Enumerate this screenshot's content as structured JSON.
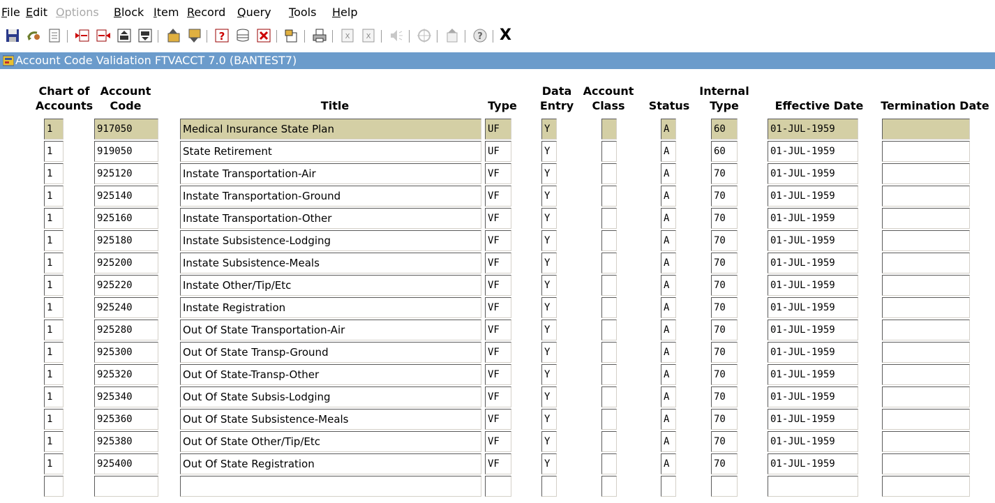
{
  "menu": [
    {
      "label": "File",
      "enabled": true
    },
    {
      "label": "Edit",
      "enabled": true
    },
    {
      "label": "Options",
      "enabled": false
    },
    {
      "label": "Block",
      "enabled": true
    },
    {
      "label": "Item",
      "enabled": true
    },
    {
      "label": "Record",
      "enabled": true
    },
    {
      "label": "Query",
      "enabled": true
    },
    {
      "label": "Tools",
      "enabled": true
    },
    {
      "label": "Help",
      "enabled": true
    }
  ],
  "toolbar": {
    "buttons": [
      "save-icon",
      "rollback-icon",
      "print-form-icon",
      "insert-record-icon",
      "remove-record-icon",
      "previous-block-icon",
      "next-block-icon",
      "previous-record-icon",
      "next-record-icon",
      "enter-query-icon",
      "execute-query-icon",
      "cancel-query-icon",
      "options-icon",
      "print-icon",
      "clear-record-icon",
      "clear-form-icon",
      "speaker-icon",
      "target-icon",
      "exit-icon",
      "help-icon"
    ],
    "exit_label": "X"
  },
  "window": {
    "title": "Account Code Validation  FTVACCT  7.0  (BANTEST7)"
  },
  "columns": {
    "chart_of_accounts": [
      "Chart of",
      "Accounts"
    ],
    "account_code": [
      "Account",
      "Code"
    ],
    "title": "Title",
    "type": "Type",
    "data_entry": [
      "Data",
      "Entry"
    ],
    "account_class": [
      "Account",
      "Class"
    ],
    "status": "Status",
    "internal_type": [
      "Internal",
      "Type"
    ],
    "effective_date": "Effective Date",
    "termination_date": "Termination Date"
  },
  "rows": [
    {
      "coas": "1",
      "acct": "917050",
      "title": "Medical Insurance State Plan",
      "type": "UF",
      "data_entry": "Y",
      "acct_class": "",
      "status": "A",
      "internal_type": "60",
      "eff_date": "01-JUL-1959",
      "term_date": ""
    },
    {
      "coas": "1",
      "acct": "919050",
      "title": "State Retirement",
      "type": "UF",
      "data_entry": "Y",
      "acct_class": "",
      "status": "A",
      "internal_type": "60",
      "eff_date": "01-JUL-1959",
      "term_date": ""
    },
    {
      "coas": "1",
      "acct": "925120",
      "title": "Instate Transportation-Air",
      "type": "VF",
      "data_entry": "Y",
      "acct_class": "",
      "status": "A",
      "internal_type": "70",
      "eff_date": "01-JUL-1959",
      "term_date": ""
    },
    {
      "coas": "1",
      "acct": "925140",
      "title": "Instate Transportation-Ground",
      "type": "VF",
      "data_entry": "Y",
      "acct_class": "",
      "status": "A",
      "internal_type": "70",
      "eff_date": "01-JUL-1959",
      "term_date": ""
    },
    {
      "coas": "1",
      "acct": "925160",
      "title": "Instate Transportation-Other",
      "type": "VF",
      "data_entry": "Y",
      "acct_class": "",
      "status": "A",
      "internal_type": "70",
      "eff_date": "01-JUL-1959",
      "term_date": ""
    },
    {
      "coas": "1",
      "acct": "925180",
      "title": "Instate Subsistence-Lodging",
      "type": "VF",
      "data_entry": "Y",
      "acct_class": "",
      "status": "A",
      "internal_type": "70",
      "eff_date": "01-JUL-1959",
      "term_date": ""
    },
    {
      "coas": "1",
      "acct": "925200",
      "title": "Instate Subsistence-Meals",
      "type": "VF",
      "data_entry": "Y",
      "acct_class": "",
      "status": "A",
      "internal_type": "70",
      "eff_date": "01-JUL-1959",
      "term_date": ""
    },
    {
      "coas": "1",
      "acct": "925220",
      "title": "Instate Other/Tip/Etc",
      "type": "VF",
      "data_entry": "Y",
      "acct_class": "",
      "status": "A",
      "internal_type": "70",
      "eff_date": "01-JUL-1959",
      "term_date": ""
    },
    {
      "coas": "1",
      "acct": "925240",
      "title": "Instate Registration",
      "type": "VF",
      "data_entry": "Y",
      "acct_class": "",
      "status": "A",
      "internal_type": "70",
      "eff_date": "01-JUL-1959",
      "term_date": ""
    },
    {
      "coas": "1",
      "acct": "925280",
      "title": "Out Of State Transportation-Air",
      "type": "VF",
      "data_entry": "Y",
      "acct_class": "",
      "status": "A",
      "internal_type": "70",
      "eff_date": "01-JUL-1959",
      "term_date": ""
    },
    {
      "coas": "1",
      "acct": "925300",
      "title": "Out Of State Transp-Ground",
      "type": "VF",
      "data_entry": "Y",
      "acct_class": "",
      "status": "A",
      "internal_type": "70",
      "eff_date": "01-JUL-1959",
      "term_date": ""
    },
    {
      "coas": "1",
      "acct": "925320",
      "title": "Out Of State-Transp-Other",
      "type": "VF",
      "data_entry": "Y",
      "acct_class": "",
      "status": "A",
      "internal_type": "70",
      "eff_date": "01-JUL-1959",
      "term_date": ""
    },
    {
      "coas": "1",
      "acct": "925340",
      "title": "Out Of State Subsis-Lodging",
      "type": "VF",
      "data_entry": "Y",
      "acct_class": "",
      "status": "A",
      "internal_type": "70",
      "eff_date": "01-JUL-1959",
      "term_date": ""
    },
    {
      "coas": "1",
      "acct": "925360",
      "title": "Out Of State Subsistence-Meals",
      "type": "VF",
      "data_entry": "Y",
      "acct_class": "",
      "status": "A",
      "internal_type": "70",
      "eff_date": "01-JUL-1959",
      "term_date": ""
    },
    {
      "coas": "1",
      "acct": "925380",
      "title": "Out Of State Other/Tip/Etc",
      "type": "VF",
      "data_entry": "Y",
      "acct_class": "",
      "status": "A",
      "internal_type": "70",
      "eff_date": "01-JUL-1959",
      "term_date": ""
    },
    {
      "coas": "1",
      "acct": "925400",
      "title": "Out Of State Registration",
      "type": "VF",
      "data_entry": "Y",
      "acct_class": "",
      "status": "A",
      "internal_type": "70",
      "eff_date": "01-JUL-1959",
      "term_date": ""
    },
    {
      "coas": "",
      "acct": "",
      "title": "",
      "type": "",
      "data_entry": "",
      "acct_class": "",
      "status": "",
      "internal_type": "",
      "eff_date": "",
      "term_date": ""
    }
  ],
  "current_row": 0,
  "colors": {
    "titlebar": "#6b9bcb",
    "current_record": "#d4cfa5"
  }
}
